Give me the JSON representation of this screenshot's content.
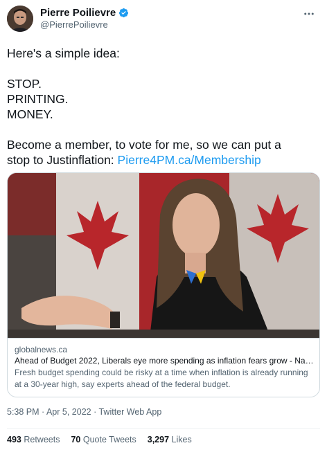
{
  "author": {
    "name": "Pierre Poilievre",
    "handle": "@PierrePoilievre",
    "verified_color": "#1d9bf0"
  },
  "tweet": {
    "lines": [
      "Here's a simple idea:",
      "STOP.",
      "PRINTING.",
      "MONEY.",
      "Become a member, to vote for me, so we can put a",
      "stop to Justinflation: "
    ],
    "link_text": "Pierre4PM.ca/Membership",
    "link_color": "#1d9bf0"
  },
  "card": {
    "domain": "globalnews.ca",
    "title": "Ahead of Budget 2022, Liberals eye more spending as inflation fears grow - Na…",
    "description": "Fresh budget spending could be risky at a time when inflation is already running at a 30-year high, say experts ahead of the federal budget."
  },
  "meta": {
    "timestamp": "5:38 PM · Apr 5, 2022 · Twitter Web App"
  },
  "stats": {
    "retweets_count": "493",
    "retweets_label": "Retweets",
    "quotes_count": "70",
    "quotes_label": "Quote Tweets",
    "likes_count": "3,297",
    "likes_label": "Likes"
  },
  "icons": {
    "verified": "verified-badge-icon",
    "more": "more-options-icon"
  }
}
